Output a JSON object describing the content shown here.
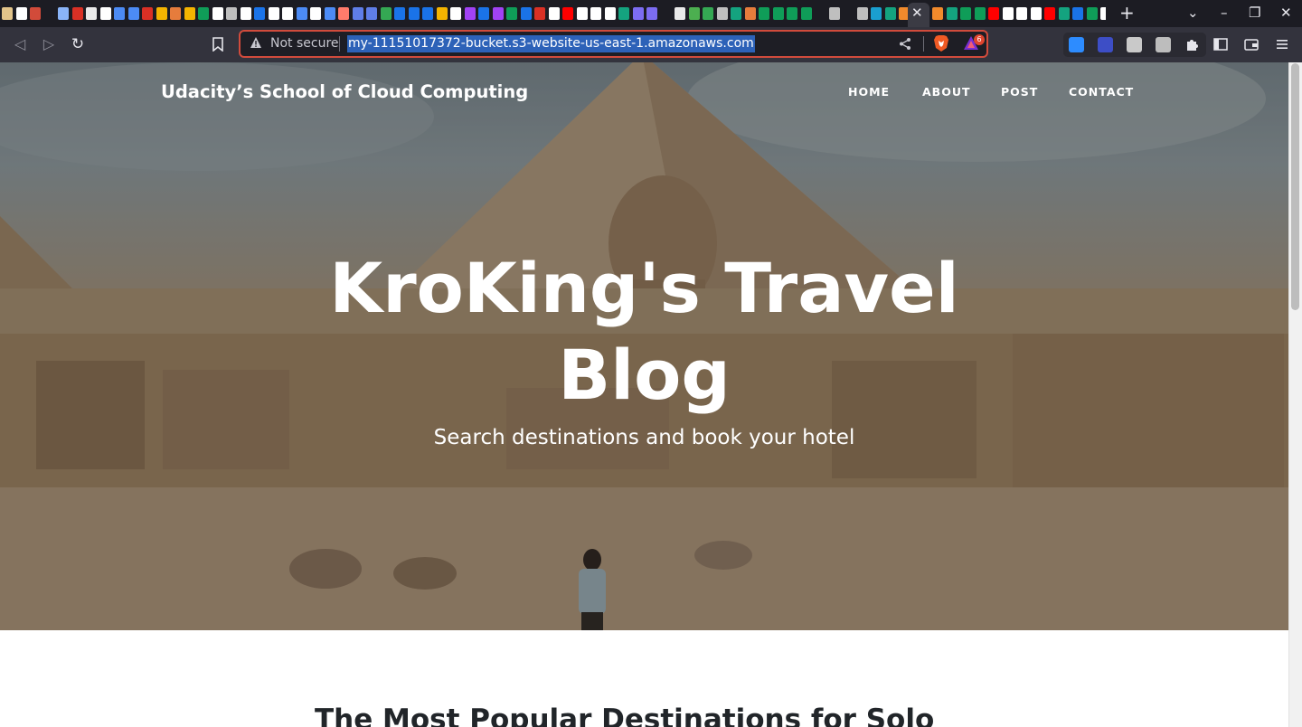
{
  "browser": {
    "tab_favicons": [
      {
        "color": "#e2c48a",
        "glyph": "",
        "title": ""
      },
      {
        "color": "#ffffff",
        "glyph": "",
        "title": ""
      },
      {
        "color": "#d24b3a",
        "glyph": "",
        "title": ""
      },
      {
        "color": "#1c1c23",
        "glyph": "",
        "title": ""
      },
      {
        "color": "#8ab4f8",
        "glyph": "",
        "title": ""
      },
      {
        "color": "#d93025",
        "glyph": "",
        "title": ""
      },
      {
        "color": "#eaeaea",
        "glyph": "",
        "title": ""
      },
      {
        "color": "#ffffff",
        "glyph": "",
        "title": ""
      },
      {
        "color": "#4c8bf5",
        "glyph": "",
        "title": ""
      },
      {
        "color": "#4c8bf5",
        "glyph": "",
        "title": ""
      },
      {
        "color": "#d93025",
        "glyph": "",
        "title": ""
      },
      {
        "color": "#f4b400",
        "glyph": "",
        "title": ""
      },
      {
        "color": "#e67c3c",
        "glyph": "",
        "title": ""
      },
      {
        "color": "#f4b400",
        "glyph": "",
        "title": ""
      },
      {
        "color": "#0f9d58",
        "glyph": "",
        "title": ""
      },
      {
        "color": "#ffffff",
        "glyph": "",
        "title": ""
      },
      {
        "color": "#bfbfbf",
        "glyph": "",
        "title": ""
      },
      {
        "color": "#ffffff",
        "glyph": "",
        "title": ""
      },
      {
        "color": "#1a73e8",
        "glyph": "",
        "title": ""
      },
      {
        "color": "#ffffff",
        "glyph": "",
        "title": ""
      },
      {
        "color": "#ffffff",
        "glyph": "",
        "title": ""
      },
      {
        "color": "#4c8bf5",
        "glyph": "",
        "title": ""
      },
      {
        "color": "#ffffff",
        "glyph": "",
        "title": ""
      },
      {
        "color": "#4c8bf5",
        "glyph": "",
        "title": ""
      },
      {
        "color": "#ff7b6b",
        "glyph": "",
        "title": ""
      },
      {
        "color": "#5f7ee8",
        "glyph": "",
        "title": ""
      },
      {
        "color": "#5f7ee8",
        "glyph": "",
        "title": ""
      },
      {
        "color": "#34a853",
        "glyph": "",
        "title": ""
      },
      {
        "color": "#1a73e8",
        "glyph": "",
        "title": ""
      },
      {
        "color": "#1a73e8",
        "glyph": "",
        "title": ""
      },
      {
        "color": "#1a73e8",
        "glyph": "",
        "title": ""
      },
      {
        "color": "#f4b400",
        "glyph": "",
        "title": ""
      },
      {
        "color": "#ffffff",
        "glyph": "",
        "title": ""
      },
      {
        "color": "#a142f4",
        "glyph": "",
        "title": ""
      },
      {
        "color": "#1a73e8",
        "glyph": "",
        "title": ""
      },
      {
        "color": "#a142f4",
        "glyph": "",
        "title": ""
      },
      {
        "color": "#0f9d58",
        "glyph": "",
        "title": ""
      },
      {
        "color": "#1a73e8",
        "glyph": "",
        "title": ""
      },
      {
        "color": "#d93025",
        "glyph": "",
        "title": ""
      },
      {
        "color": "#ffffff",
        "glyph": "",
        "title": ""
      },
      {
        "color": "#ff0000",
        "glyph": "",
        "title": ""
      },
      {
        "color": "#ffffff",
        "glyph": "",
        "title": ""
      },
      {
        "color": "#ffffff",
        "glyph": "",
        "title": ""
      },
      {
        "color": "#ffffff",
        "glyph": "",
        "title": ""
      },
      {
        "color": "#14a37f",
        "glyph": "",
        "title": ""
      },
      {
        "color": "#7c6cf2",
        "glyph": "",
        "title": ""
      },
      {
        "color": "#7c6cf2",
        "glyph": "",
        "title": ""
      },
      {
        "color": "#1c1c23",
        "glyph": "",
        "title": ""
      },
      {
        "color": "#eaeaea",
        "glyph": "",
        "title": ""
      },
      {
        "color": "#4caf50",
        "glyph": "",
        "title": ""
      },
      {
        "color": "#34a853",
        "glyph": "",
        "title": ""
      },
      {
        "color": "#bfbfbf",
        "glyph": "",
        "title": ""
      },
      {
        "color": "#14a37f",
        "glyph": "",
        "title": ""
      },
      {
        "color": "#e67c3c",
        "glyph": "",
        "title": ""
      },
      {
        "color": "#0f9d58",
        "glyph": "",
        "title": ""
      },
      {
        "color": "#0f9d58",
        "glyph": "",
        "title": ""
      },
      {
        "color": "#0f9d58",
        "glyph": "",
        "title": ""
      },
      {
        "color": "#0f9d58",
        "glyph": "",
        "title": ""
      },
      {
        "color": "#1c1c23",
        "glyph": "",
        "title": ""
      },
      {
        "color": "#bfbfbf",
        "glyph": "",
        "title": ""
      },
      {
        "color": "#1c1c23",
        "glyph": "",
        "title": ""
      },
      {
        "color": "#bfbfbf",
        "glyph": "",
        "title": ""
      },
      {
        "color": "#1a9fcf",
        "glyph": "",
        "title": ""
      },
      {
        "color": "#14a37f",
        "glyph": "",
        "title": ""
      },
      {
        "color": "#f18a2c",
        "glyph": "",
        "title": ""
      }
    ],
    "tab_favicons_after_active": [
      {
        "color": "#f18a2c",
        "glyph": "",
        "title": ""
      },
      {
        "color": "#14a37f",
        "glyph": "",
        "title": ""
      },
      {
        "color": "#0f9d58",
        "glyph": "",
        "title": ""
      },
      {
        "color": "#0f9d58",
        "glyph": "",
        "title": ""
      },
      {
        "color": "#ff0000",
        "glyph": "",
        "title": ""
      },
      {
        "color": "#ffffff",
        "glyph": "",
        "title": ""
      },
      {
        "color": "#ffffff",
        "glyph": "",
        "title": ""
      },
      {
        "color": "#ffffff",
        "glyph": "",
        "title": ""
      },
      {
        "color": "#ff0000",
        "glyph": "",
        "title": ""
      },
      {
        "color": "#14a37f",
        "glyph": "",
        "title": ""
      },
      {
        "color": "#1a73e8",
        "glyph": "",
        "title": ""
      },
      {
        "color": "#0f9d58",
        "glyph": "",
        "title": ""
      },
      {
        "color": "#ffffff",
        "glyph": "",
        "title": ""
      }
    ],
    "close_glyph": "✕",
    "newtab_glyph": "+",
    "window": {
      "minimize": "–",
      "maximize": "❐",
      "close": "✕",
      "tabs_dropdown": "⌄"
    },
    "nav": {
      "back": "◁",
      "forward": "▷",
      "reload": "↻"
    },
    "address": {
      "security_label": "Not secure",
      "url": "my-11151017372-bucket.s3-website-us-east-1.amazonaws.com"
    },
    "rewards_count": "6",
    "colors": {
      "chrome": "#1c1c23",
      "toolbar": "#33333d",
      "url_border": "#d14b3c",
      "url_highlight": "#2d62b8"
    }
  },
  "site": {
    "brand": "Udacity’s School of Cloud Computing",
    "nav": [
      {
        "label": "HOME"
      },
      {
        "label": "ABOUT"
      },
      {
        "label": "POST"
      },
      {
        "label": "CONTACT"
      }
    ],
    "hero": {
      "title": "KroKing's Travel Blog",
      "subtitle": "Search destinations and book your hotel"
    },
    "section_title": "The Most Popular Destinations for Solo"
  }
}
